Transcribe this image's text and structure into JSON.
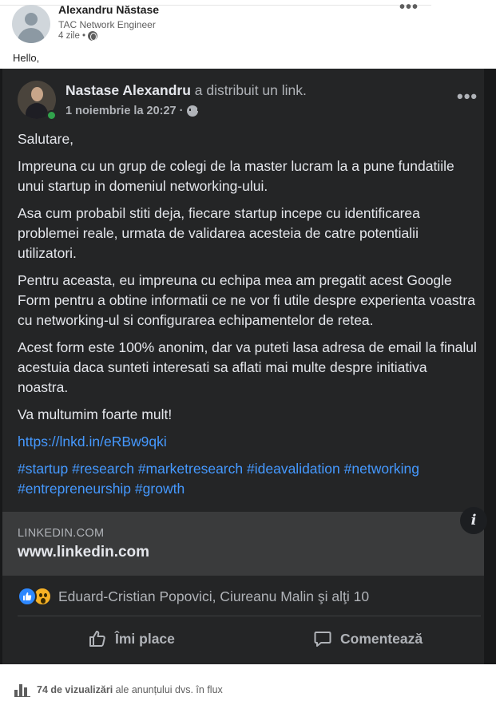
{
  "outer_post": {
    "author_name": "Alexandru Năstase",
    "author_title": "TAC Network Engineer",
    "time": "4 zile •",
    "text": "Hello,"
  },
  "shared_post": {
    "author_name": "Nastase Alexandru",
    "action": "a distribuit un link.",
    "date": "1 noiembrie la 20:27 ·",
    "paragraphs": [
      "Salutare,",
      "Impreuna cu un grup de colegi de la master lucram la a pune fundatiile unui startup in domeniul networking-ului.",
      "Asa cum probabil stiti deja, fiecare startup incepe cu identificarea problemei reale, urmata de validarea acesteia de catre potentialii utilizatori.",
      "Pentru aceasta, eu impreuna cu echipa mea am pregatit acest Google Form pentru a obtine informatii ce ne vor fi utile despre experienta voastra cu networking-ul si configurarea echipamentelor de retea.",
      "Acest form este 100% anonim, dar va puteti lasa adresa de email la finalul acestuia daca sunteti interesati sa aflati mai multe despre initiativa noastra.",
      "Va multumim foarte mult!"
    ],
    "link": "https://lnkd.in/eRBw9qki",
    "hashtags": [
      "#startup",
      "#research",
      "#marketresearch",
      "#ideavalidation",
      "#networking",
      "#entrepreneurship",
      "#growth"
    ],
    "link_card": {
      "domain": "LINKEDIN.COM",
      "title": "www.linkedin.com",
      "info_glyph": "i"
    },
    "reactions_text": "Eduard-Cristian Popovici, Ciureanu Malin şi alţi 10",
    "like_label": "Îmi place",
    "comment_label": "Comentează"
  },
  "footer": {
    "views_count": "74 de vizualizări",
    "views_text": "ale anunțului dvs. în flux"
  },
  "colors": {
    "dark_bg": "#242526",
    "link_blue": "#4599ff",
    "like_blue": "#2d88ff"
  }
}
